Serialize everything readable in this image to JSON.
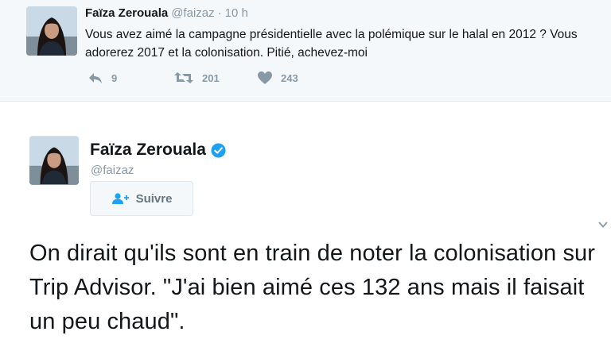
{
  "top_tweet": {
    "name": "Faïza Zerouala",
    "handle": "@faizaz",
    "separator": "·",
    "time": "10 h",
    "text": "Vous avez aimé la campagne présidentielle avec la polémique sur le halal en 2012 ? Vous adorerez 2017 et la colonisation. Pitié, achevez-moi",
    "replies": "9",
    "retweets": "201",
    "likes": "243"
  },
  "main_tweet": {
    "name": "Faïza Zerouala",
    "handle": "@faizaz",
    "follow_label": "Suivre",
    "text": "On dirait qu'ils sont en train de noter la colonisation sur Trip Advisor. \"J'ai bien aimé ces 132 ans mais il faisait un peu chaud\"."
  },
  "icons": {
    "reply": "reply-icon",
    "retweet": "retweet-icon",
    "like": "heart-icon",
    "verified": "verified-badge-icon",
    "follow": "add-user-icon",
    "menu": "chevron-down-icon"
  },
  "colors": {
    "name": "#14171a",
    "muted": "#8899a6",
    "verified": "#1da1f2",
    "top_background": "#f5f8fa",
    "divider": "#e1e8ed"
  }
}
